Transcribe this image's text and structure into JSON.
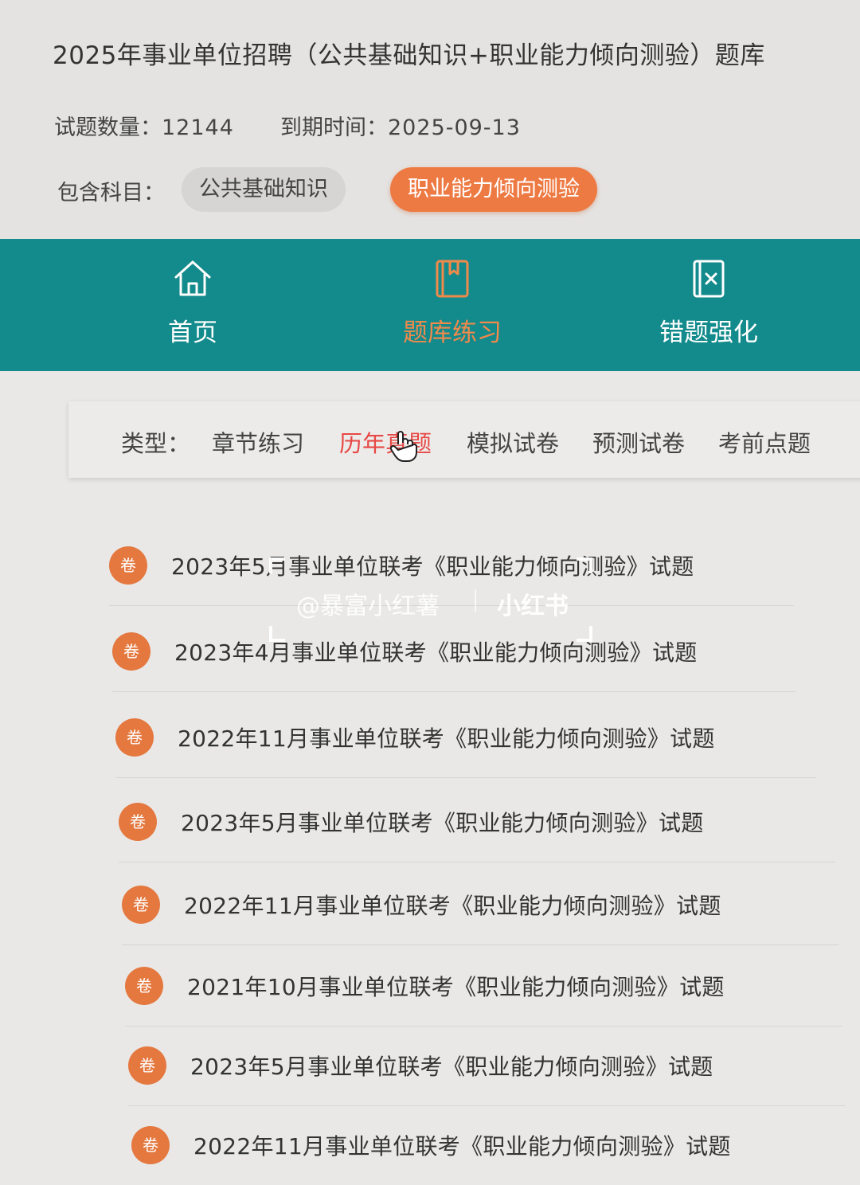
{
  "header": {
    "title": "2025年事业单位招聘（公共基础知识+职业能力倾向测验）题库",
    "question_count_label": "试题数量：",
    "question_count": "12144",
    "expiry_label": "到期时间：",
    "expiry_date": "2025-09-13",
    "subjects_label": "包含科目：",
    "subjects": [
      {
        "label": "公共基础知识",
        "active": false
      },
      {
        "label": "职业能力倾向测验",
        "active": true
      }
    ]
  },
  "nav": {
    "items": [
      {
        "label": "首页",
        "icon": "home-icon",
        "active": false
      },
      {
        "label": "题库练习",
        "icon": "book-icon",
        "active": true
      },
      {
        "label": "错题强化",
        "icon": "wrong-notebook-icon",
        "active": false
      }
    ]
  },
  "filter": {
    "label": "类型：",
    "items": [
      {
        "label": "章节练习",
        "active": false
      },
      {
        "label": "历年真题",
        "active": true
      },
      {
        "label": "模拟试卷",
        "active": false
      },
      {
        "label": "预测试卷",
        "active": false
      },
      {
        "label": "考前点题",
        "active": false
      }
    ]
  },
  "list": {
    "badge": "卷",
    "items": [
      "2023年5月事业单位联考《职业能力倾向测验》试题",
      "2023年4月事业单位联考《职业能力倾向测验》试题",
      "2022年11月事业单位联考《职业能力倾向测验》试题",
      "2023年5月事业单位联考《职业能力倾向测验》试题",
      "2022年11月事业单位联考《职业能力倾向测验》试题",
      "2021年10月事业单位联考《职业能力倾向测验》试题",
      "2023年5月事业单位联考《职业能力倾向测验》试题",
      "2022年11月事业单位联考《职业能力倾向测验》试题"
    ]
  },
  "watermark": {
    "handle": "@暴富小红薯",
    "brand": "小红书"
  },
  "colors": {
    "accent": "#ee7a43",
    "nav_bg": "#138a8c",
    "filter_active": "#e74845"
  }
}
